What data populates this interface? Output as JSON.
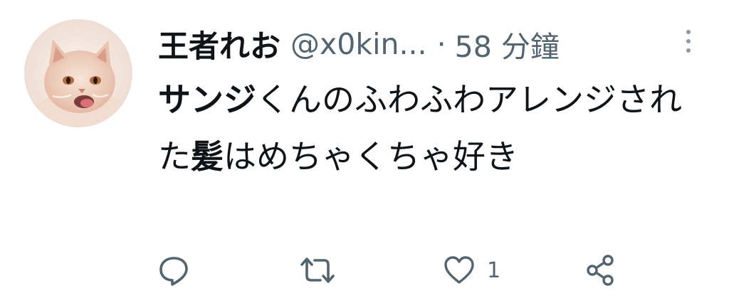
{
  "tweet": {
    "author": {
      "display_name": "王者れお",
      "handle": "@x0kin...",
      "avatar_icon": "cat-avatar"
    },
    "separator": "·",
    "timestamp": "58 分鐘",
    "text": {
      "part1_bold": "サンジ",
      "part2": "くんのふわふわアレンジされた",
      "part3_bold": "髪",
      "part4": "はめちゃくちゃ好き"
    },
    "actions": {
      "reply": {
        "icon": "reply-icon",
        "count": ""
      },
      "retweet": {
        "icon": "retweet-icon",
        "count": ""
      },
      "like": {
        "icon": "heart-icon",
        "count": "1"
      },
      "share": {
        "icon": "share-icon",
        "count": ""
      }
    },
    "colors": {
      "text": "#0f1419",
      "secondary": "#536471",
      "icon": "#536471"
    }
  }
}
